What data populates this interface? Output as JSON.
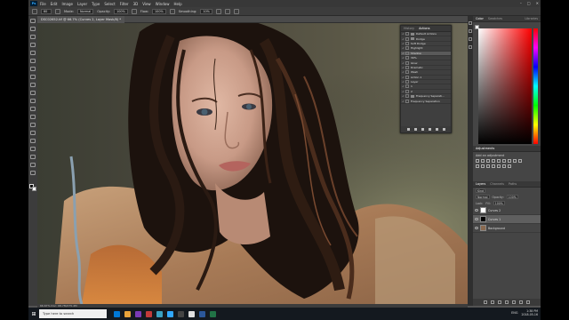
{
  "app": {
    "logo": "Ps"
  },
  "menu": [
    "File",
    "Edit",
    "Image",
    "Layer",
    "Type",
    "Select",
    "Filter",
    "3D",
    "View",
    "Window",
    "Help"
  ],
  "window_controls": [
    "–",
    "□",
    "✕"
  ],
  "options_bar": {
    "size": "60",
    "mode_label": "Mode:",
    "mode_value": "Normal",
    "opacity_label": "Opacity:",
    "opacity_value": "100%",
    "flow_label": "Flow:",
    "flow_value": "100%",
    "smoothing_label": "Smoothing:",
    "smoothing_value": "10%"
  },
  "document_tab": "DSC02652.tif @ 66.7% (Curves 2, Layer Mask/8) *",
  "status": "66.67%   Doc: 68.7M/275.4M",
  "actions_panel": {
    "tabs": [
      "History",
      "Actions"
    ],
    "active_tab": "Actions",
    "rows": [
      {
        "label": "Default Actions",
        "type": "folder"
      },
      {
        "label": "Dodge",
        "type": "folder"
      },
      {
        "label": "Soft Dodge",
        "type": "item"
      },
      {
        "label": "Highlight",
        "type": "item"
      },
      {
        "label": "Shadow",
        "type": "item",
        "highlight": true
      },
      {
        "label": "30%",
        "type": "item"
      },
      {
        "label": "Glow",
        "type": "item"
      },
      {
        "label": "Dramatic",
        "type": "item"
      },
      {
        "label": "Wash",
        "type": "item"
      },
      {
        "label": "Action 1",
        "type": "item"
      },
      {
        "label": "Layer",
        "type": "item"
      },
      {
        "label": "1",
        "type": "item"
      },
      {
        "label": "2",
        "type": "item"
      },
      {
        "label": "Frequency Separati...",
        "type": "folder"
      },
      {
        "label": "Frequency Separation",
        "type": "item"
      }
    ]
  },
  "color_panel": {
    "tabs": [
      "Color",
      "Swatches"
    ],
    "active_tab": "Color",
    "colors": {
      "foreground": "#ffffff",
      "hue": "#ff0000"
    }
  },
  "library_label": "Libraries",
  "adjustments_panel": {
    "title": "Adjustments",
    "subtitle": "Add an adjustment"
  },
  "layers_panel": {
    "tabs": [
      "Layers",
      "Channels",
      "Paths"
    ],
    "active_tab": "Layers",
    "kind_label": "Kind",
    "blend_mode": "Normal",
    "opacity_label": "Opacity:",
    "opacity_value": "100%",
    "lock_label": "Lock:",
    "fill_label": "Fill:",
    "fill_value": "100%",
    "layers": [
      {
        "name": "Curves 2",
        "thumb": "white",
        "selected": false
      },
      {
        "name": "Curves 1",
        "thumb": "dark",
        "selected": true
      },
      {
        "name": "Background",
        "thumb": "photo",
        "selected": false
      }
    ]
  },
  "taskbar": {
    "search_placeholder": "Type here to search",
    "apps": [
      "#0078d7",
      "#e8a33a",
      "#7a3ab6",
      "#c23a3a",
      "#3aa1c2",
      "#31a8ff",
      "#444444",
      "#e0e0e0",
      "#2b579a",
      "#217346"
    ],
    "lang": "ENG",
    "time": "1:38 PM",
    "date": "2018-05-16"
  }
}
